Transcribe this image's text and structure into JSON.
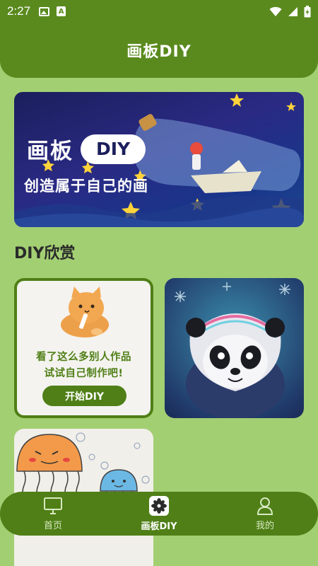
{
  "status_bar": {
    "time": "2:27",
    "left_icons": [
      "image-icon",
      "font-a-icon"
    ],
    "right_icons": [
      "wifi-icon",
      "signal-icon",
      "battery-charging-icon"
    ]
  },
  "header": {
    "title": "画板DIY"
  },
  "banner": {
    "title": "画板",
    "pill": "DIY",
    "subtitle": "创造属于自己的画"
  },
  "section": {
    "title": "DIY欣赏"
  },
  "promo_card": {
    "line1": "看了这么多别人作品",
    "line2": "试试自己制作吧!",
    "button_label": "开始DIY"
  },
  "bottom_nav": {
    "items": [
      {
        "label": "首页",
        "icon": "monitor-icon",
        "active": false
      },
      {
        "label": "画板DIY",
        "icon": "flower-icon",
        "active": true
      },
      {
        "label": "我的",
        "icon": "user-icon",
        "active": false
      }
    ]
  },
  "colors": {
    "primary": "#5a8a1e",
    "nav": "#4f7f16",
    "background": "#a3cf73"
  }
}
